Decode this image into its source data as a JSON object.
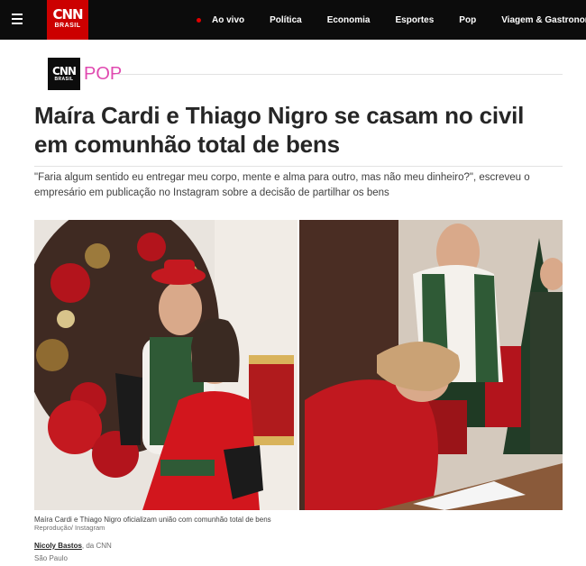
{
  "header": {
    "logo": {
      "main": "CNN",
      "sub": "BRASIL"
    },
    "nav": [
      {
        "label": "Ao vivo",
        "live": true
      },
      {
        "label": "Política"
      },
      {
        "label": "Economia"
      },
      {
        "label": "Esportes"
      },
      {
        "label": "Pop"
      },
      {
        "label": "Viagem & Gastronomia"
      }
    ],
    "icons": {
      "menu": "hamburger-menu-icon",
      "live": "live-dot-icon"
    },
    "colors": {
      "bar": "#0c0c0c",
      "brand_red": "#cc0000",
      "live_dot": "#e10000"
    }
  },
  "section": {
    "logo_main": "CNN",
    "logo_sub": "BRASIL",
    "name": "POP",
    "accent": "#e04ab0"
  },
  "article": {
    "title": "Maíra Cardi e Thiago Nigro se casam no civil em comunhão total de bens",
    "dek": "\"Faria algum sentido eu entregar meu corpo, mente e alma para outro, mas não meu dinheiro?\", escreveu o empresário em publicação no Instagram sobre a decisão de partilhar os bens",
    "image": {
      "caption": "Maíra Cardi e Thiago Nigro oficializam união com comunhão total de bens",
      "credit": "Reprodução/ Instagram"
    },
    "byline": {
      "author": "Nicoly Bastos",
      "outlet": ", da CNN",
      "location": "São Paulo"
    }
  }
}
